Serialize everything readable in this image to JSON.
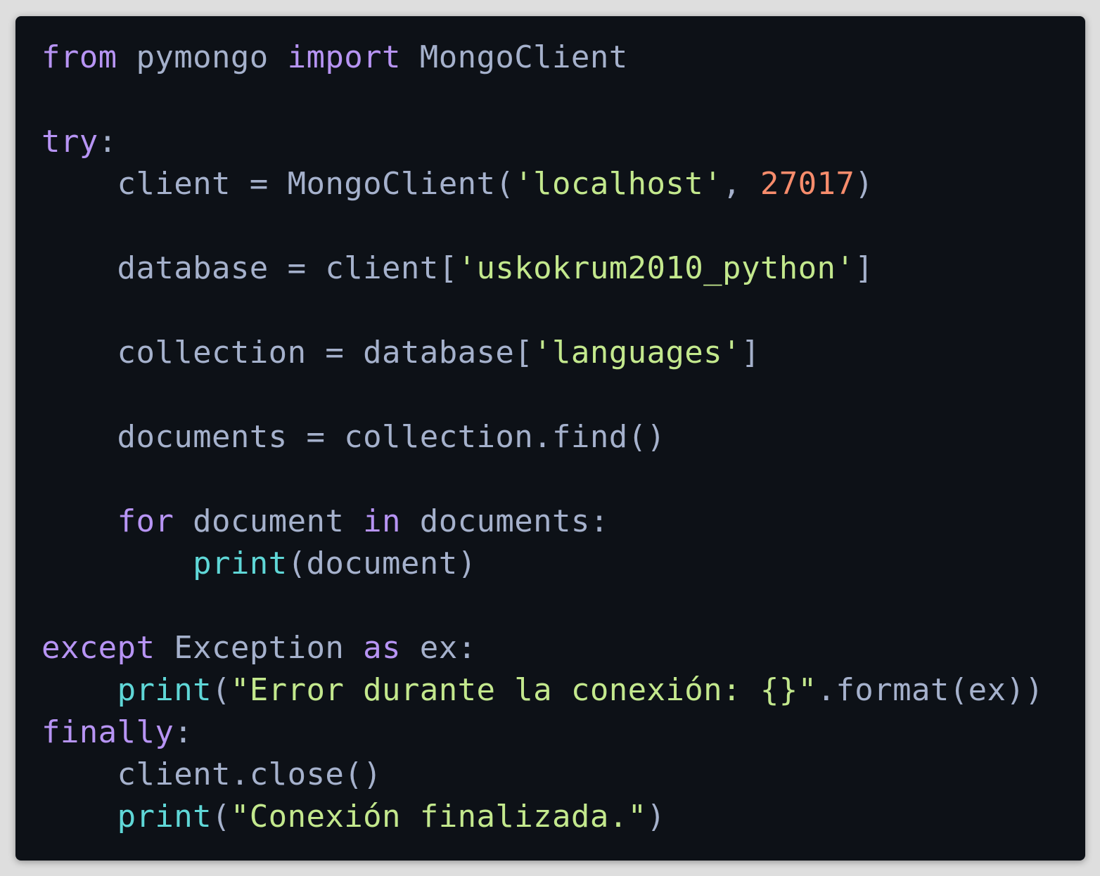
{
  "theme": {
    "background": "#0d1117",
    "page_background": "#dedede",
    "keyword": "#b794f4",
    "identifier": "#a5b1cc",
    "string": "#c3e88d",
    "number": "#f78c6c",
    "builtin": "#5fd7d7"
  },
  "lines": [
    [
      {
        "t": "kw",
        "v": "from"
      },
      {
        "t": "id",
        "v": " pymongo "
      },
      {
        "t": "kw",
        "v": "import"
      },
      {
        "t": "id",
        "v": " MongoClient"
      }
    ],
    [],
    [
      {
        "t": "kw",
        "v": "try"
      },
      {
        "t": "id",
        "v": ":"
      }
    ],
    [
      {
        "t": "id",
        "v": "    client = MongoClient("
      },
      {
        "t": "str",
        "v": "'localhost'"
      },
      {
        "t": "id",
        "v": ", "
      },
      {
        "t": "num",
        "v": "27017"
      },
      {
        "t": "id",
        "v": ")"
      }
    ],
    [],
    [
      {
        "t": "id",
        "v": "    database = client["
      },
      {
        "t": "str",
        "v": "'uskokrum2010_python'"
      },
      {
        "t": "id",
        "v": "]"
      }
    ],
    [],
    [
      {
        "t": "id",
        "v": "    collection = database["
      },
      {
        "t": "str",
        "v": "'languages'"
      },
      {
        "t": "id",
        "v": "]"
      }
    ],
    [],
    [
      {
        "t": "id",
        "v": "    documents = collection.find()"
      }
    ],
    [],
    [
      {
        "t": "id",
        "v": "    "
      },
      {
        "t": "kw",
        "v": "for"
      },
      {
        "t": "id",
        "v": " document "
      },
      {
        "t": "kw",
        "v": "in"
      },
      {
        "t": "id",
        "v": " documents:"
      }
    ],
    [
      {
        "t": "id",
        "v": "        "
      },
      {
        "t": "fn",
        "v": "print"
      },
      {
        "t": "id",
        "v": "(document)"
      }
    ],
    [],
    [
      {
        "t": "kw",
        "v": "except"
      },
      {
        "t": "id",
        "v": " Exception "
      },
      {
        "t": "kw",
        "v": "as"
      },
      {
        "t": "id",
        "v": " ex:"
      }
    ],
    [
      {
        "t": "id",
        "v": "    "
      },
      {
        "t": "fn",
        "v": "print"
      },
      {
        "t": "id",
        "v": "("
      },
      {
        "t": "str",
        "v": "\"Error durante la conexión: {}\""
      },
      {
        "t": "id",
        "v": ".format(ex))"
      }
    ],
    [
      {
        "t": "kw",
        "v": "finally"
      },
      {
        "t": "id",
        "v": ":"
      }
    ],
    [
      {
        "t": "id",
        "v": "    client.close()"
      }
    ],
    [
      {
        "t": "id",
        "v": "    "
      },
      {
        "t": "fn",
        "v": "print"
      },
      {
        "t": "id",
        "v": "("
      },
      {
        "t": "str",
        "v": "\"Conexión finalizada.\""
      },
      {
        "t": "id",
        "v": ")"
      }
    ]
  ]
}
